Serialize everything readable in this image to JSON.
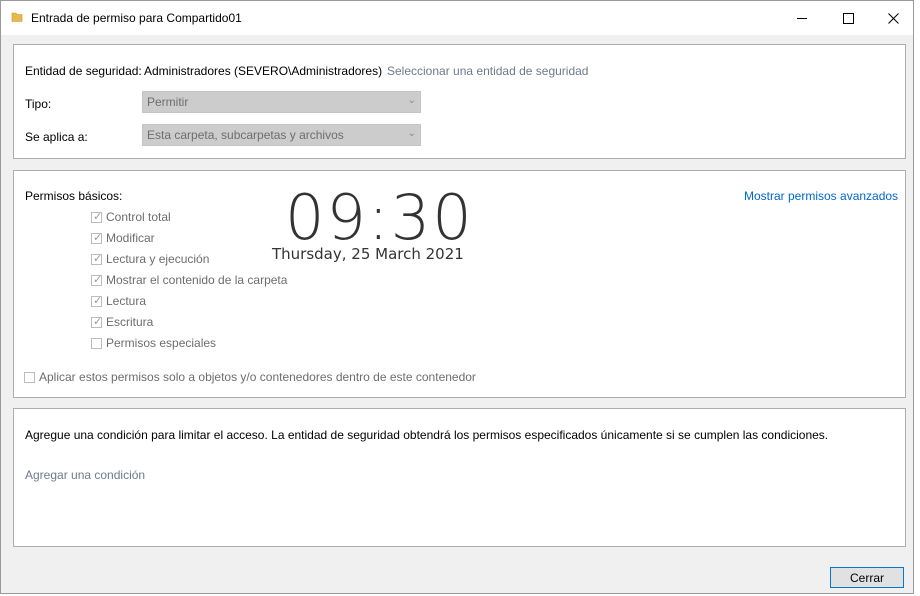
{
  "window": {
    "title": "Entrada de permiso para Compartido01",
    "minimize_glyph": "—",
    "maximize_glyph": "☐",
    "close_glyph": "✕"
  },
  "principal": {
    "label": "Entidad de seguridad:",
    "value": "Administradores (SEVERO\\Administradores)",
    "select_link": "Seleccionar una entidad de seguridad"
  },
  "type": {
    "label": "Tipo:",
    "value": "Permitir"
  },
  "applies_to": {
    "label": "Se aplica a:",
    "value": "Esta carpeta, subcarpetas y archivos"
  },
  "permissions": {
    "heading": "Permisos básicos:",
    "advanced_link": "Mostrar permisos avanzados",
    "items": [
      {
        "label": "Control total",
        "checked": true
      },
      {
        "label": "Modificar",
        "checked": true
      },
      {
        "label": "Lectura y ejecución",
        "checked": true
      },
      {
        "label": "Mostrar el contenido de la carpeta",
        "checked": true
      },
      {
        "label": "Lectura",
        "checked": true
      },
      {
        "label": "Escritura",
        "checked": true
      },
      {
        "label": "Permisos especiales",
        "checked": false
      }
    ],
    "apply_only": {
      "label": "Aplicar estos permisos solo a objetos y/o contenedores dentro de este contenedor",
      "checked": false
    }
  },
  "clock": {
    "time": "09:30",
    "date": "Thursday, 25 March 2021"
  },
  "condition": {
    "description": "Agregue una condición para limitar el acceso. La entidad de seguridad obtendrá los permisos especificados únicamente si se cumplen las condiciones.",
    "add_link": "Agregar una condición"
  },
  "footer": {
    "close_label": "Cerrar"
  },
  "colors": {
    "accent": "#0078d7",
    "link": "#0066cc",
    "disabled": "#6d6d6d"
  }
}
